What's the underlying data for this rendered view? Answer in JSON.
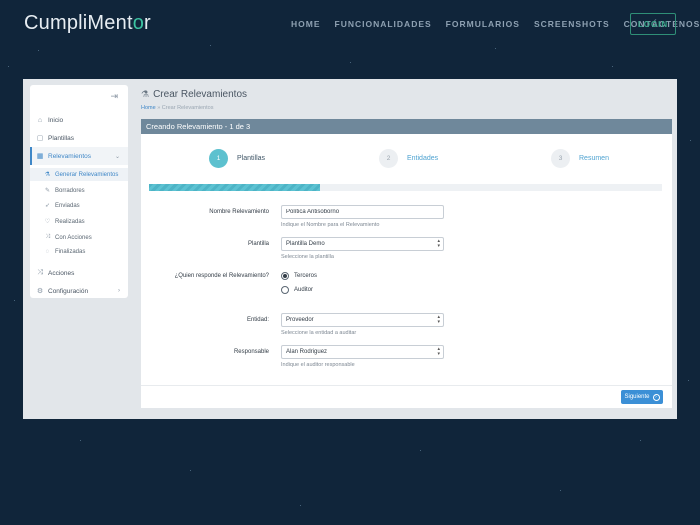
{
  "brand": {
    "name_prefix": "CumpliMent",
    "name_o": "o",
    "name_suffix": "r"
  },
  "nav": [
    {
      "label": "HOME"
    },
    {
      "label": "FUNCIONALIDADES"
    },
    {
      "label": "FORMULARIOS"
    },
    {
      "label": "SCREENSHOTS"
    },
    {
      "label": "CONTÁCTENOS"
    }
  ],
  "login_label": "LOGIN",
  "sidebar": {
    "items": [
      {
        "label": "Inicio",
        "icon": "home-icon"
      },
      {
        "label": "Plantillas",
        "icon": "box-icon"
      },
      {
        "label": "Relevamientos",
        "icon": "grid-icon"
      },
      {
        "label": "Acciones",
        "icon": "shuffle-icon"
      },
      {
        "label": "Configuración",
        "icon": "gear-icon"
      }
    ],
    "subitems": [
      {
        "label": "Generar Relevamientos",
        "icon": "flask-icon"
      },
      {
        "label": "Borradores",
        "icon": "edit-icon"
      },
      {
        "label": "Enviadas",
        "icon": "send-icon"
      },
      {
        "label": "Realizadas",
        "icon": "bulb-icon"
      },
      {
        "label": "Con Acciones",
        "icon": "shuffle-icon"
      },
      {
        "label": "Finalizadas",
        "icon": "check-circle-icon"
      }
    ]
  },
  "page": {
    "title": "Crear Relevamientos",
    "breadcrumb_home": "Home",
    "breadcrumb_sep": "»",
    "breadcrumb_current": "Crear Relevamientos"
  },
  "panel": {
    "header": "Creando Relevamiento - 1 de 3"
  },
  "steps": [
    {
      "num": "1",
      "label": "Plantillas"
    },
    {
      "num": "2",
      "label": "Entidades"
    },
    {
      "num": "3",
      "label": "Resumen"
    }
  ],
  "progress_fraction": 0.333,
  "form": {
    "nombre": {
      "label": "Nombre Relevamiento",
      "value": "Política Antisoborno",
      "help": "Indique el Nombre para el Relevamiento"
    },
    "plantilla": {
      "label": "Plantilla",
      "value": "Plantilla Demo",
      "help": "Seleccione la plantilla"
    },
    "responde": {
      "label": "¿Quien responde el Relevamiento?",
      "options": [
        "Terceros",
        "Auditor"
      ],
      "selected": "Terceros"
    },
    "entidad": {
      "label": "Entidad:",
      "value": "Proveedor",
      "help": "Seleccione la entidad a auditar"
    },
    "responsable": {
      "label": "Responsable",
      "value": "Alan Rodriguez",
      "help": "Indique el auditor responsable"
    }
  },
  "next_label": "Siguiente",
  "colors": {
    "accent": "#3f87c7",
    "step_active": "#5dc1cf",
    "panel_header": "#6f889b",
    "background": "#10253a"
  }
}
